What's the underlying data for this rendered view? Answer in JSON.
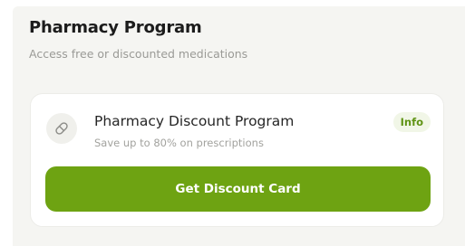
{
  "section": {
    "title": "Pharmacy Program",
    "subtitle": "Access free or discounted medications"
  },
  "program": {
    "icon": "pill-icon",
    "name": "Pharmacy Discount Program",
    "description": "Save up to 80% on prescriptions",
    "badge": "Info",
    "button_label": "Get Discount Card"
  },
  "colors": {
    "accent": "#6ea312",
    "badge_text": "#5f9314",
    "badge_bg": "#f1f6e7",
    "panel_bg": "#f5f5f2",
    "card_bg": "#ffffff"
  }
}
